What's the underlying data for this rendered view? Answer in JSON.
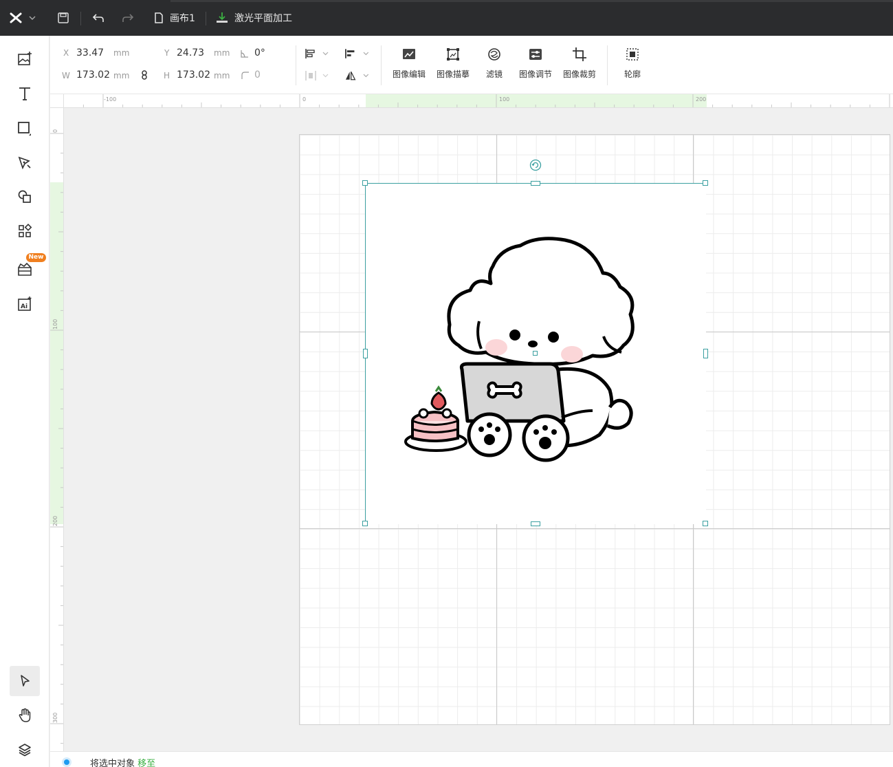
{
  "topbar": {
    "canvas_name": "画布1",
    "mode_label": "激光平面加工"
  },
  "properties": {
    "x_label": "X",
    "x_value": "33.47",
    "x_unit": "mm",
    "y_label": "Y",
    "y_value": "24.73",
    "y_unit": "mm",
    "w_label": "W",
    "w_value": "173.02",
    "w_unit": "mm",
    "h_label": "H",
    "h_value": "173.02",
    "h_unit": "mm",
    "rotation_value": "0°",
    "corner_value": "0"
  },
  "image_tools": [
    {
      "label": "图像编辑",
      "icon": "image-edit-icon"
    },
    {
      "label": "图像描摹",
      "icon": "image-trace-icon"
    },
    {
      "label": "滤镜",
      "icon": "filter-icon"
    },
    {
      "label": "图像调节",
      "icon": "image-adjust-icon"
    },
    {
      "label": "图像裁剪",
      "icon": "image-crop-icon"
    },
    {
      "label": "轮廓",
      "icon": "outline-icon"
    }
  ],
  "left_tools": {
    "new_badge": "New"
  },
  "ruler_top": {
    "labels": [
      "-100",
      "0",
      "100",
      "200"
    ]
  },
  "ruler_left": {
    "labels": [
      "0",
      "100",
      "200",
      "300"
    ]
  },
  "status": {
    "message": "将选中对象",
    "action_link": "移至"
  },
  "colors": {
    "accent": "#3cb043",
    "selection": "#3a9fa0",
    "badge": "#f07f1f",
    "topbar": "#2b2c2e"
  }
}
